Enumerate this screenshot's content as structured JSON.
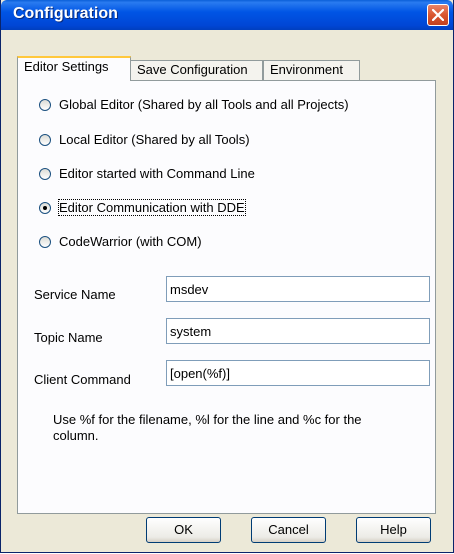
{
  "window": {
    "title": "Configuration",
    "close_icon": "close-icon"
  },
  "tabs": [
    {
      "label": "Editor Settings",
      "active": true
    },
    {
      "label": "Save Configuration",
      "active": false
    },
    {
      "label": "Environment",
      "active": false
    }
  ],
  "editor_options": [
    {
      "label": "Global Editor (Shared by all Tools and all Projects)",
      "selected": false
    },
    {
      "label": "Local Editor (Shared by all Tools)",
      "selected": false
    },
    {
      "label": "Editor started with Command Line",
      "selected": false
    },
    {
      "label": "Editor Communication with DDE",
      "selected": true
    },
    {
      "label": "CodeWarrior (with COM)",
      "selected": false
    }
  ],
  "fields": {
    "service_name": {
      "label": "Service Name",
      "value": "msdev"
    },
    "topic_name": {
      "label": "Topic Name",
      "value": "system"
    },
    "client_command": {
      "label": "Client Command",
      "value": "[open(%f)]"
    }
  },
  "hint": "Use %f for the filename, %l for the line and %c for the column.",
  "buttons": {
    "ok": "OK",
    "cancel": "Cancel",
    "help": "Help"
  }
}
